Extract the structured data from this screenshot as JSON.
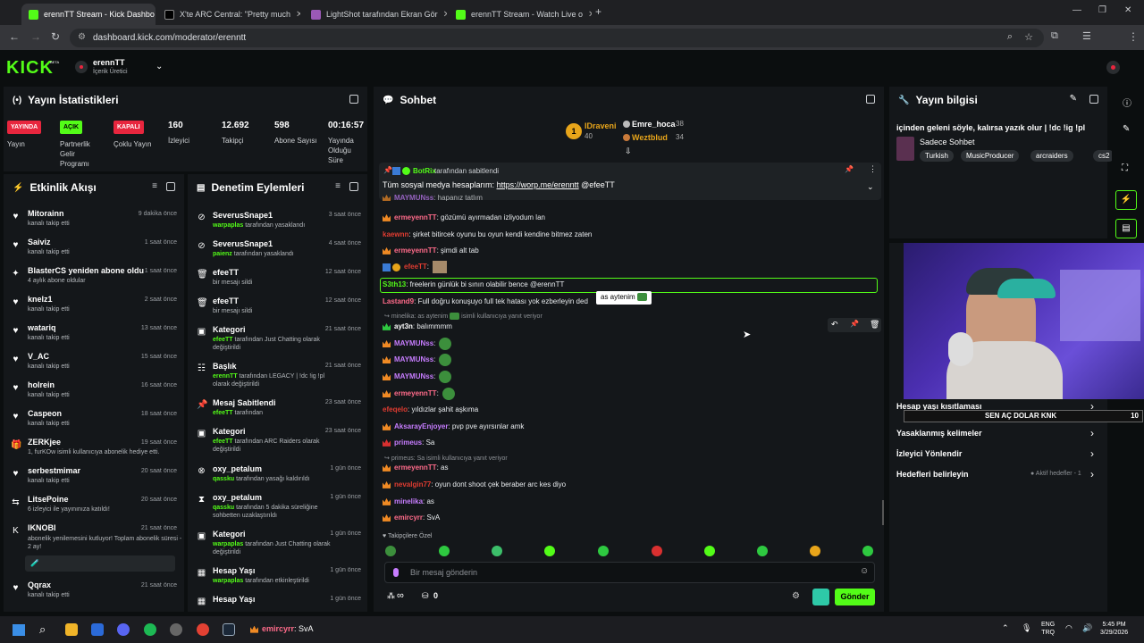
{
  "browser": {
    "tabs": [
      {
        "label": "erennTT Stream - Kick Dashbo",
        "favicon": "kick-icon"
      },
      {
        "label": "X'te ARC Central: \"Pretty much",
        "favicon": "x-icon"
      },
      {
        "label": "LightShot tarafından Ekran Gör",
        "favicon": "lightshot-icon"
      },
      {
        "label": "erennTT Stream - Watch Live o",
        "favicon": "kick-icon"
      }
    ],
    "url": "dashboard.kick.com/moderator/erenntt"
  },
  "header": {
    "logo": "KICK",
    "logo_beta": "BETA",
    "channel_name": "erennTT",
    "channel_role": "İçerik Üretici"
  },
  "stats_panel": {
    "title": "Yayın İstatistikleri",
    "items": [
      {
        "badge": "YAYINDA",
        "label": "Yayın",
        "color": "#e8263e"
      },
      {
        "badge": "AÇIK",
        "label": "Partnerlik Gelir Programı",
        "color": "#53fc18"
      },
      {
        "badge": "KAPALI",
        "label": "Çoklu Yayın",
        "color": "#e8263e"
      },
      {
        "value": "160",
        "label": "İzleyici"
      },
      {
        "value": "12.692",
        "label": "Takipçi"
      },
      {
        "value": "598",
        "label": "Abone Sayısı"
      },
      {
        "value": "00:16:57",
        "label": "Yayında Olduğu Süre"
      }
    ]
  },
  "activity_feed": {
    "title": "Etkinlik Akışı",
    "items": [
      {
        "name": "Mitorainn",
        "sub": "kanalı takip etti",
        "time": "9 dakika önce",
        "icon": "heart-icon"
      },
      {
        "name": "Saiviz",
        "sub": "kanalı takip etti",
        "time": "1 saat önce",
        "icon": "heart-icon"
      },
      {
        "name": "BlasterCS yeniden abone oldu!",
        "sub": "4 aylık abone oldular",
        "time": "1 saat önce",
        "icon": "star-icon"
      },
      {
        "name": "knelz1",
        "sub": "kanalı takip etti",
        "time": "2 saat önce",
        "icon": "heart-icon"
      },
      {
        "name": "watariq",
        "sub": "kanalı takip etti",
        "time": "13 saat önce",
        "icon": "heart-icon"
      },
      {
        "name": "V_AC",
        "sub": "kanalı takip etti",
        "time": "15 saat önce",
        "icon": "heart-icon"
      },
      {
        "name": "holrein",
        "sub": "kanalı takip etti",
        "time": "16 saat önce",
        "icon": "heart-icon"
      },
      {
        "name": "Caspeon",
        "sub": "kanalı takip etti",
        "time": "18 saat önce",
        "icon": "heart-icon"
      },
      {
        "name": "ZERKjee",
        "sub": "1, furKOw isimli kullanıcıya abonelik hediye etti.",
        "time": "19 saat önce",
        "icon": "gift-icon"
      },
      {
        "name": "serbestmimar",
        "sub": "kanalı takip etti",
        "time": "20 saat önce",
        "icon": "heart-icon"
      },
      {
        "name": "LitsePoine",
        "sub": "6 izleyici ile yayınınıza katıldı!",
        "time": "20 saat önce",
        "icon": "raid-icon"
      },
      {
        "name": "IKNOBI",
        "sub": "abonelik yenilemesini kutluyor! Toplam abonelik süresi - 2 ay!",
        "time": "21 saat önce",
        "icon": "kick-k-icon"
      },
      {
        "name": "Qqrax",
        "sub": "kanalı takip etti",
        "time": "21 saat önce",
        "icon": "heart-icon"
      }
    ]
  },
  "mod_actions": {
    "title": "Denetim Eylemleri",
    "items": [
      {
        "name": "SeverusSnape1",
        "actor": "warpaplas",
        "sub": "tarafından yasaklandı",
        "time": "3 saat önce",
        "icon": "ban-icon"
      },
      {
        "name": "SeverusSnape1",
        "actor": "paienz",
        "sub": "tarafından yasaklandı",
        "time": "4 saat önce",
        "icon": "ban-icon"
      },
      {
        "name": "efeeTT",
        "actor": "",
        "sub": "bir mesajı sildi",
        "time": "12 saat önce",
        "icon": "trash-icon"
      },
      {
        "name": "efeeTT",
        "actor": "",
        "sub": "bir mesajı sildi",
        "time": "12 saat önce",
        "icon": "trash-icon"
      },
      {
        "name": "Kategori",
        "actor": "efeeTT",
        "sub": "tarafından Just Chatting olarak değiştirildi",
        "time": "21 saat önce",
        "icon": "category-icon"
      },
      {
        "name": "Başlık",
        "actor": "erennTT",
        "sub": "tarafından LEGACY | !dc !ig !pl olarak değiştirildi",
        "time": "21 saat önce",
        "icon": "title-icon"
      },
      {
        "name": "Mesaj Sabitlendi",
        "actor": "efeeTT",
        "sub": "tarafından",
        "time": "23 saat önce",
        "icon": "pin-icon"
      },
      {
        "name": "Kategori",
        "actor": "efeeTT",
        "sub": "tarafından ARC Raiders olarak değiştirildi",
        "time": "23 saat önce",
        "icon": "category-icon"
      },
      {
        "name": "oxy_petalum",
        "actor": "qassku",
        "sub": "tarafından yasağı kaldırıldı",
        "time": "1 gün önce",
        "icon": "unban-icon"
      },
      {
        "name": "oxy_petalum",
        "actor": "qassku",
        "sub": "tarafından 5 dakika süreliğine sohbetten uzaklaştırıldı",
        "time": "1 gün önce",
        "icon": "timeout-icon"
      },
      {
        "name": "Kategori",
        "actor": "warpaplas",
        "sub": "tarafından Just Chatting olarak değiştirildi",
        "time": "1 gün önce",
        "icon": "category-icon"
      },
      {
        "name": "Hesap Yaşı",
        "actor": "warpaplas",
        "sub": "tarafından etkinleştirildi",
        "time": "1 gün önce",
        "icon": "calendar-icon"
      },
      {
        "name": "Hesap Yaşı",
        "actor": "",
        "sub": "",
        "time": "1 gün önce",
        "icon": "calendar-icon"
      }
    ]
  },
  "chat": {
    "title": "Sohbet",
    "leaderboard": [
      {
        "name": "IDraveni",
        "score": "40"
      },
      {
        "name": "Emre_hoca",
        "score": "38"
      },
      {
        "name": "Weztblud",
        "score": "34"
      }
    ],
    "pinned": {
      "by": "BotRix",
      "by_suffix": "tarafından sabitlendi",
      "text": "Tüm sosyal medya hesaplarım:",
      "link": "https://worp.me/erenntt",
      "mention": "@efeeTT"
    },
    "messages": [
      {
        "user": "MAYMUNss",
        "text": ": hapanız tatlım",
        "color": "#c77dff"
      },
      {
        "user": "ermeyennTT",
        "text": ": gözümü ayırmadan izliyodum lan",
        "color": "#ff6b8a"
      },
      {
        "user": "kaewnn",
        "text": ": şirket bitircek oyunu bu oyun kendi kendine bitmez zaten",
        "color": "#e03c31"
      },
      {
        "user": "ermeyennTT",
        "text": ": şimdi alt tab",
        "color": "#ff6b8a"
      },
      {
        "user": "efeeTT",
        "text": ":",
        "color": "#e03c31"
      },
      {
        "user": "S3th13",
        "text": ": freelerin günlük bi sının olabilir bence @erennTT",
        "color": "#53fc18"
      },
      {
        "user": "Lastand9",
        "text": ": Full doğru konuşuyo full tek hatası yok ezberleyin ded",
        "color": "#ff6b8a"
      },
      {
        "user": "ayt3n",
        "text": ": balımmmm",
        "color": "#ffffff"
      },
      {
        "user": "MAYMUNss",
        "text": ":",
        "color": "#c77dff"
      },
      {
        "user": "MAYMUNss",
        "text": ":",
        "color": "#c77dff"
      },
      {
        "user": "MAYMUNss",
        "text": ":",
        "color": "#c77dff"
      },
      {
        "user": "ermeyennTT",
        "text": ":",
        "color": "#ff6b8a"
      },
      {
        "user": "efeqelo",
        "text": ": yıldızlar şahit aşkıma",
        "color": "#e03c31"
      },
      {
        "user": "AksarayEnjoyer",
        "text": ": pvp pve ayırsınlar amk",
        "color": "#c77dff"
      },
      {
        "user": "primeus",
        "text": ": Sa",
        "color": "#c77dff"
      },
      {
        "user": "ermeyennTT",
        "text": ": as",
        "color": "#ff6b8a"
      },
      {
        "user": "nevalgin77",
        "text": ": oyun dont shoot çek beraber arc kes diyo",
        "color": "#e03c31"
      },
      {
        "user": "minelika",
        "text": ": as",
        "color": "#c77dff"
      },
      {
        "user": "emircyrr",
        "text": ": SvA",
        "color": "#ff6b8a"
      }
    ],
    "reply_1": "minelika: as aytenim",
    "reply_1_suffix": "isimli kullanıcıya yanıt veriyor",
    "reply_2": "primeus: Sa isimli kullanıcıya yanıt veriyor",
    "tooltip": "as aytenim",
    "followers_only": "Takipçilere Özel",
    "input_placeholder": "Bir mesaj gönderin",
    "send_label": "Gönder",
    "infinity_label": "∞",
    "count_label": "0"
  },
  "stream_info": {
    "title": "Yayın bilgisi",
    "stream_title": "içinden geleni söyle, kalırsa yazık olur | !dc !ig !pl",
    "category": "Sadece Sohbet",
    "tags": [
      "Turkish",
      "MusicProducer",
      "arcraiders",
      "cs2"
    ],
    "links": [
      {
        "label": "Hesap yaşı kısıtlaması"
      },
      {
        "label": "Yasaklanmış kelimeler"
      },
      {
        "label": "İzleyici Yönlendir"
      },
      {
        "label": "Hedefleri belirleyin",
        "note": "● Aktif hedefler - 1"
      }
    ],
    "overlay_banner": "SEN AÇ DOLAR KNK",
    "overlay_count": "10"
  },
  "taskbar": {
    "chat_preview_user": "emircyrr",
    "chat_preview_text": ": SvA",
    "lang": "ENG",
    "lang2": "TRQ",
    "time": "5:45 PM",
    "date": "3/29/2026"
  }
}
